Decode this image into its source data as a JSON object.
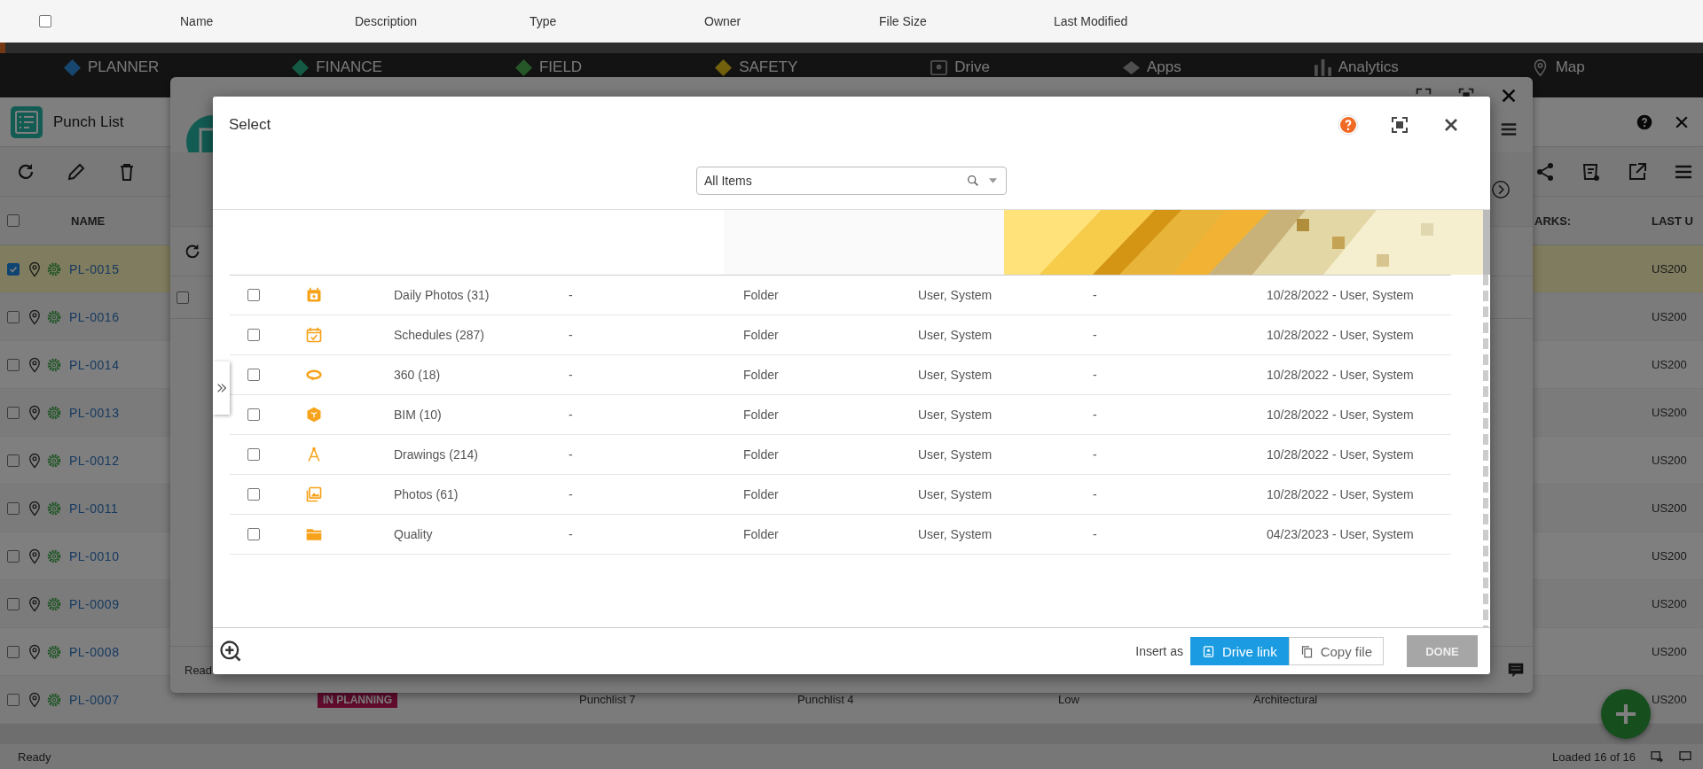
{
  "file_header": {
    "checked": false,
    "columns": [
      "Name",
      "Description",
      "Type",
      "Owner",
      "File Size",
      "Last Modified"
    ]
  },
  "nav": [
    {
      "label": "PLANNER",
      "kind": "planner"
    },
    {
      "label": "FINANCE",
      "kind": "finance"
    },
    {
      "label": "FIELD",
      "kind": "field"
    },
    {
      "label": "SAFETY",
      "kind": "safety"
    },
    {
      "label": "Drive",
      "kind": "drive"
    },
    {
      "label": "Apps",
      "kind": "apps"
    },
    {
      "label": "Analytics",
      "kind": "chart"
    },
    {
      "label": "Map",
      "kind": "pin"
    }
  ],
  "app": {
    "title": "Punch List",
    "header_checked": false,
    "columns": [
      "NAME",
      "ARKS:",
      "LAST U"
    ],
    "rows": [
      {
        "id": "PL-0015",
        "checked": true,
        "selected": true,
        "last": "US200"
      },
      {
        "id": "PL-0016",
        "checked": false,
        "selected": false,
        "last": "US200"
      },
      {
        "id": "PL-0014",
        "checked": false,
        "selected": false,
        "last": "US200"
      },
      {
        "id": "PL-0013",
        "checked": false,
        "selected": false,
        "last": "US200"
      },
      {
        "id": "PL-0012",
        "checked": false,
        "selected": false,
        "last": "US200"
      },
      {
        "id": "PL-0011",
        "checked": false,
        "selected": false,
        "last": "US200"
      },
      {
        "id": "PL-0010",
        "checked": false,
        "selected": false,
        "last": "US200"
      },
      {
        "id": "PL-0009",
        "checked": false,
        "selected": false,
        "last": "US200"
      },
      {
        "id": "PL-0008",
        "checked": false,
        "selected": false,
        "last": "US200"
      },
      {
        "id": "PL-0007",
        "checked": false,
        "selected": false,
        "status": "IN PLANNING",
        "cells": [
          "Punchlist 7",
          "Punchlist 4",
          "Low",
          "Architectural"
        ],
        "last": "US200"
      }
    ]
  },
  "status_bar": {
    "left": "Ready",
    "right": "Loaded 16 of 16"
  },
  "back_window": {
    "checked": false,
    "status": "Read"
  },
  "dialog": {
    "title": "Select",
    "search": {
      "value": "All Items"
    },
    "rows": [
      {
        "kind": "photo-calendar",
        "name": "Daily Photos (31)",
        "description": "-",
        "type": "Folder",
        "owner": "User, System",
        "size": "-",
        "modified": "10/28/2022 - User, System",
        "checked": false
      },
      {
        "kind": "calendar",
        "name": "Schedules (287)",
        "description": "-",
        "type": "Folder",
        "owner": "User, System",
        "size": "-",
        "modified": "10/28/2022 - User, System",
        "checked": false
      },
      {
        "kind": "rotate",
        "name": "360 (18)",
        "description": "-",
        "type": "Folder",
        "owner": "User, System",
        "size": "-",
        "modified": "10/28/2022 - User, System",
        "checked": false
      },
      {
        "kind": "cube",
        "name": "BIM (10)",
        "description": "-",
        "type": "Folder",
        "owner": "User, System",
        "size": "-",
        "modified": "10/28/2022 - User, System",
        "checked": false
      },
      {
        "kind": "compass",
        "name": "Drawings (214)",
        "description": "-",
        "type": "Folder",
        "owner": "User, System",
        "size": "-",
        "modified": "10/28/2022 - User, System",
        "checked": false
      },
      {
        "kind": "photos",
        "name": "Photos (61)",
        "description": "-",
        "type": "Folder",
        "owner": "User, System",
        "size": "-",
        "modified": "10/28/2022 - User, System",
        "checked": false
      },
      {
        "kind": "folder",
        "name": "Quality",
        "description": "-",
        "type": "Folder",
        "owner": "User, System",
        "size": "-",
        "modified": "04/23/2023 - User, System",
        "checked": false
      }
    ],
    "insert_label": "Insert as",
    "options": [
      {
        "kind": "link",
        "label": "Drive link",
        "selected": true
      },
      {
        "kind": "copy",
        "label": "Copy file",
        "selected": false
      }
    ],
    "done": {
      "label": "DONE",
      "disabled": true
    }
  }
}
